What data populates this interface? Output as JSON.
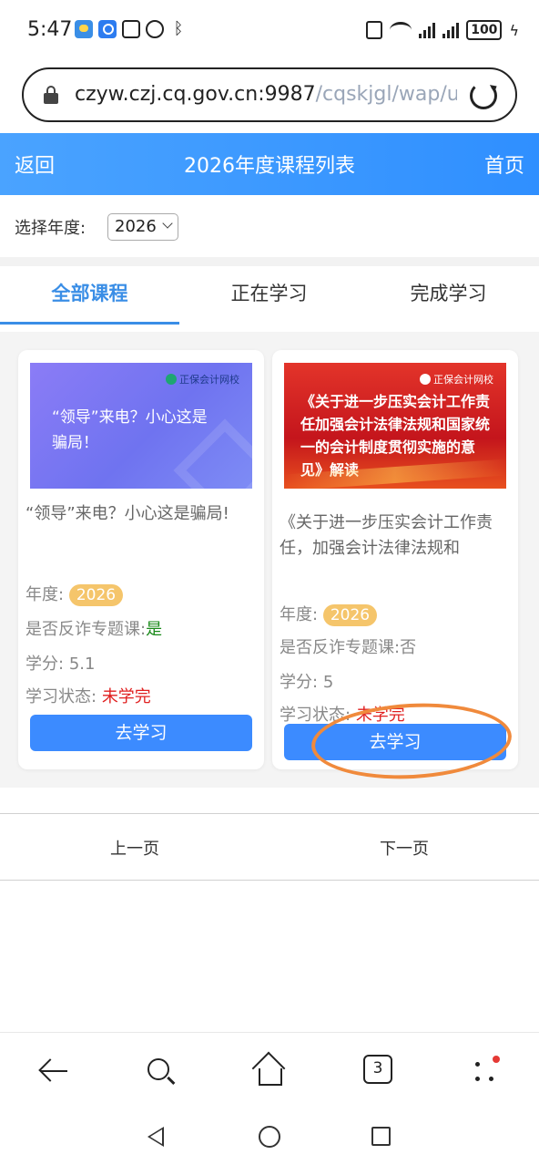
{
  "status_bar": {
    "time": "5:47",
    "battery": "100",
    "icons": [
      "weather-icon",
      "search-app-icon",
      "nfc-icon",
      "alarm-icon",
      "bluetooth-icon",
      "vibrate-icon",
      "wifi-icon",
      "signal-icon",
      "signal-icon",
      "battery-icon",
      "charging-icon"
    ]
  },
  "url_bar": {
    "host": "czyw.czj.cq.gov.cn:9987",
    "path": "/cqskjgl/wap/u"
  },
  "header": {
    "back": "返回",
    "title": "2026年度课程列表",
    "home": "首页",
    "colors": {
      "start": "#4aa3ff",
      "end": "#2f8fff"
    }
  },
  "year_filter": {
    "label": "选择年度:",
    "selected": "2026"
  },
  "tabs": [
    {
      "label": "全部课程",
      "active": true
    },
    {
      "label": "正在学习",
      "active": false
    },
    {
      "label": "完成学习",
      "active": false
    }
  ],
  "courses": [
    {
      "thumb_logo": "正保会计网校",
      "thumb_text": "“领导”来电？小心这是骗局！",
      "title": "“领导”来电？小心这是骗局!",
      "year_label": "年度:",
      "year": "2026",
      "anti_fraud_label": "是否反诈专题课:",
      "anti_fraud": "是",
      "credit_label": "学分:",
      "credit": "5.1",
      "status_label": "学习状态:",
      "status": "未学完",
      "button": "去学习"
    },
    {
      "thumb_logo": "正保会计网校",
      "thumb_text": "《关于进一步压实会计工作责任加强会计法律法规和国家统一的会计制度贯彻实施的意见》解读",
      "title": "《关于进一步压实会计工作责任，加强会计法律法规和",
      "year_label": "年度:",
      "year": "2026",
      "anti_fraud_label": "是否反诈专题课:",
      "anti_fraud": "否",
      "credit_label": "学分:",
      "credit": "5",
      "status_label": "学习状态:",
      "status": "未学完",
      "button": "去学习"
    }
  ],
  "pager": {
    "prev": "上一页",
    "next": "下一页"
  },
  "browser_toolbar": {
    "tab_count": "3"
  },
  "colors": {
    "accent": "#3a8ee6",
    "button": "#3c8bff",
    "badge": "#f5c56b",
    "status_red": "#e02020",
    "yes_green": "#1a8a1a",
    "annotation": "#f08a3c"
  }
}
